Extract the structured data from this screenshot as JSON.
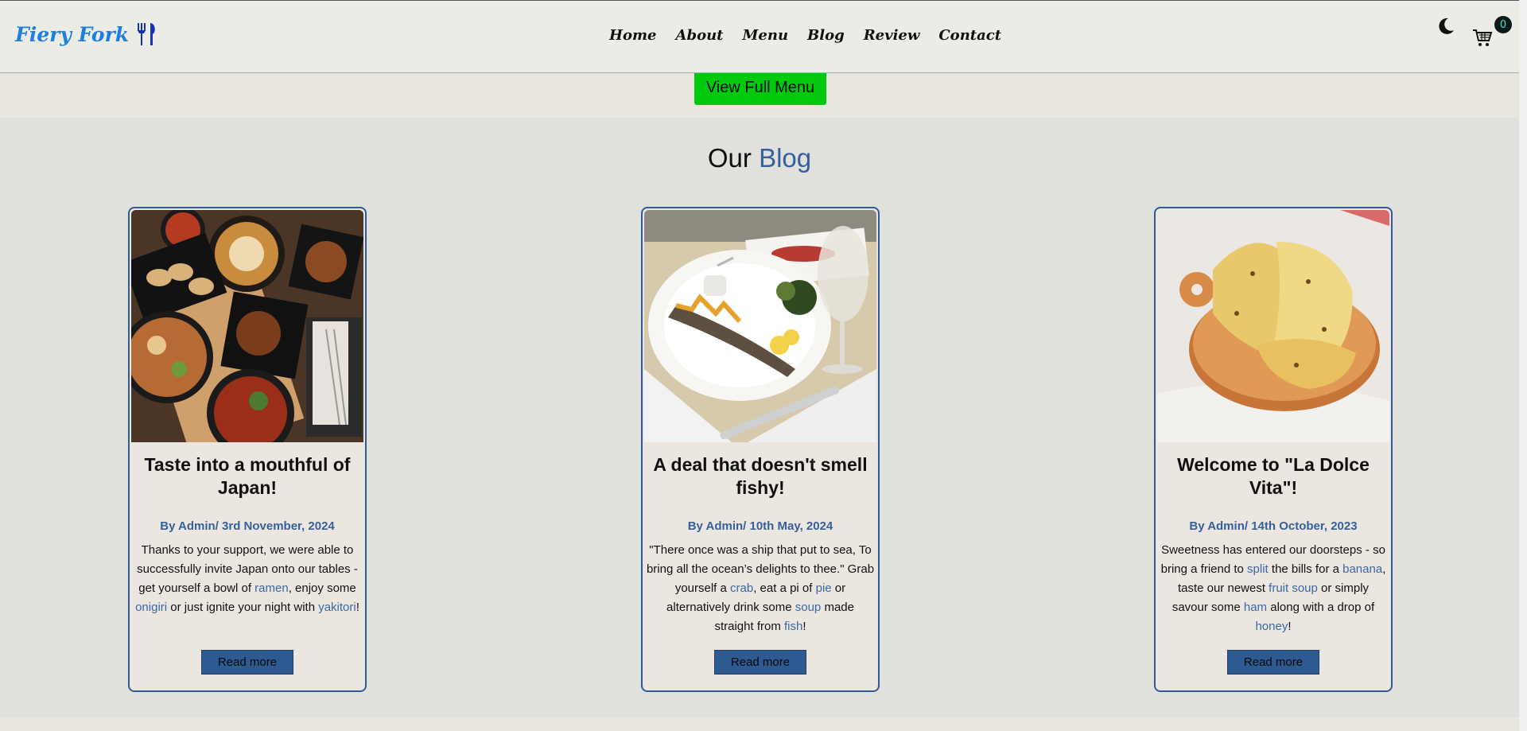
{
  "header": {
    "logo_text": "Fiery Fork",
    "nav": [
      "Home",
      "About",
      "Menu",
      "Blog",
      "Review",
      "Contact"
    ],
    "cart_count": "0"
  },
  "menu": {
    "view_full_menu": "View Full Menu"
  },
  "blog": {
    "title_prefix": "Our",
    "title_accent": "Blog",
    "posts": [
      {
        "title": "Taste into a mouthful of Japan!",
        "meta": "By Admin/ 3rd November, 2024",
        "text_parts": [
          {
            "t": "Thanks to your support, we were able to successfully invite Japan onto our tables - get yourself a bowl of ",
            "kw": false
          },
          {
            "t": "ramen",
            "kw": true
          },
          {
            "t": ", enjoy some ",
            "kw": false
          },
          {
            "t": "onigiri",
            "kw": true
          },
          {
            "t": " or just ignite your night with ",
            "kw": false
          },
          {
            "t": "yakitori",
            "kw": true
          },
          {
            "t": "!",
            "kw": false
          }
        ],
        "read_more": "Read more"
      },
      {
        "title": "A deal that doesn't smell fishy!",
        "meta": "By Admin/ 10th May, 2024",
        "text_parts": [
          {
            "t": "\"There once was a ship that put to sea, To bring all the ocean’s delights to thee.\" Grab yourself a ",
            "kw": false
          },
          {
            "t": "crab",
            "kw": true
          },
          {
            "t": ", eat a pi of ",
            "kw": false
          },
          {
            "t": "pie",
            "kw": true
          },
          {
            "t": " or alternatively drink some ",
            "kw": false
          },
          {
            "t": "soup",
            "kw": true
          },
          {
            "t": " made straight from ",
            "kw": false
          },
          {
            "t": "fish",
            "kw": true
          },
          {
            "t": "!",
            "kw": false
          }
        ],
        "read_more": "Read more"
      },
      {
        "title": "Welcome to \"La Dolce Vita\"!",
        "meta": "By Admin/ 14th October, 2023",
        "text_parts": [
          {
            "t": "Sweetness has entered our doorsteps - so bring a friend to ",
            "kw": false
          },
          {
            "t": "split",
            "kw": true
          },
          {
            "t": " the bills for a ",
            "kw": false
          },
          {
            "t": "banana",
            "kw": true
          },
          {
            "t": ", taste our newest ",
            "kw": false
          },
          {
            "t": "fruit soup",
            "kw": true
          },
          {
            "t": " or simply savour some ",
            "kw": false
          },
          {
            "t": "ham",
            "kw": true
          },
          {
            "t": " along with a drop of ",
            "kw": false
          },
          {
            "t": "honey",
            "kw": true
          },
          {
            "t": "!",
            "kw": false
          }
        ],
        "read_more": "Read more"
      }
    ]
  },
  "colors": {
    "logo_blue": "#1d7fe0",
    "accent_blue": "#36609a",
    "button_green": "#00c90e",
    "badge_teal": "#3ce0c9"
  }
}
